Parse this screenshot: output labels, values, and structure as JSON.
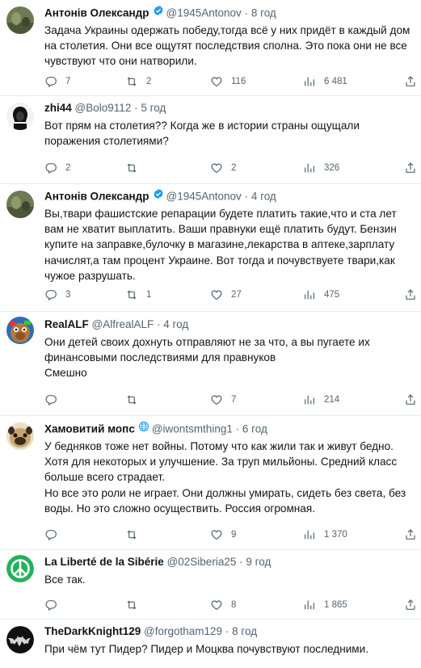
{
  "tweets": [
    {
      "name": "Антонів Олександр",
      "verified": true,
      "handle": "@1945Antonov",
      "sep": "·",
      "time": "8 год",
      "text": "Задача Украины одержать победу,тогда всё у них придёт в каждый дом на столетия. Они все ощутят последствия сполна. Это пока они не все чувствуют что они натворили.",
      "replies": "7",
      "retweets": "2",
      "likes": "116",
      "views": "6 481"
    },
    {
      "name": "zhi44",
      "verified": false,
      "handle": "@Bolo9112",
      "sep": "·",
      "time": "5 год",
      "text": "Вот прям на столетия?? Когда же в истории страны ощущали поражения столетиями?",
      "replies": "2",
      "retweets": "",
      "likes": "2",
      "views": "326"
    },
    {
      "name": "Антонів Олександр",
      "verified": true,
      "handle": "@1945Antonov",
      "sep": "·",
      "time": "4 год",
      "text": "Вы,твари фашистские репарации будете платить такие,что и ста лет вам не хватит выплатить. Ваши правнуки ещё платить будут. Бензин купите на заправке,булочку в магазине,лекарства в аптеке,зарплату начислят,а там процент Украине. Вот тогда и почувствуете твари,как чужое разрушать.",
      "replies": "3",
      "retweets": "1",
      "likes": "27",
      "views": "475"
    },
    {
      "name": "RealALF",
      "verified": false,
      "handle": "@AlfrealALF",
      "sep": "·",
      "time": "4 год",
      "text": "Они детей своих дохнуть отправляют не за что, а вы пугаете их финансовыми последствиями для правнуков\nСмешно",
      "replies": "",
      "retweets": "",
      "likes": "7",
      "views": "214"
    },
    {
      "name": "Хамовитий мопс",
      "verified": false,
      "globe": true,
      "handle": "@iwontsmthing1",
      "sep": "·",
      "time": "6 год",
      "text": "У бедняков тоже нет войны. Потому что как жили так и живут бедно. Хотя для некоторых и улучшение. За труп мильйоны. Средний класс больше всего страдает.\nНо все это роли не играет. Они должны умирать, сидеть без света, без воды. Но это сложно осуществить. Россия огромная.",
      "replies": "",
      "retweets": "",
      "likes": "9",
      "views": "1 370"
    },
    {
      "name": "La Liberté de la Sibérie",
      "verified": false,
      "handle": "@02Siberia25",
      "sep": "·",
      "time": "9 год",
      "text": "Все так.",
      "replies": "",
      "retweets": "",
      "likes": "8",
      "views": "1 865"
    },
    {
      "name": "TheDarkKnight129",
      "verified": false,
      "handle": "@forgotham129",
      "sep": "·",
      "time": "8 год",
      "text": "При чём тут Пидер? Пидер и Моцква почувствуют последними.",
      "replies": "",
      "retweets": "",
      "likes": "",
      "views": ""
    }
  ],
  "colors": {
    "accent": "#1d9bf0",
    "muted": "#536471",
    "text": "#0f1419",
    "border": "#e6ecf0"
  },
  "icons": [
    "reply-icon",
    "retweet-icon",
    "like-icon",
    "views-icon",
    "share-icon",
    "verified-badge-icon",
    "globe-icon"
  ]
}
